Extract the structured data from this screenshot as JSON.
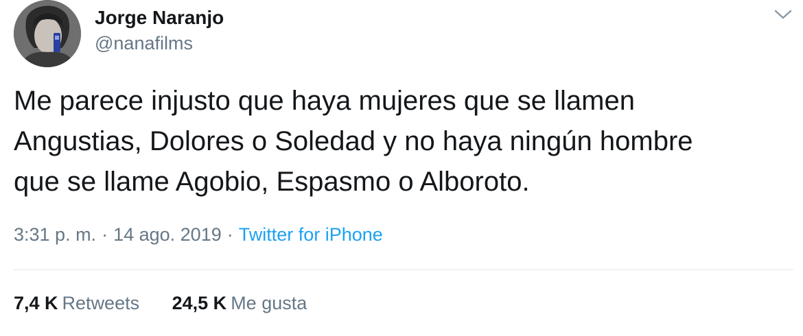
{
  "user": {
    "display_name": "Jorge Naranjo",
    "handle": "@nanafilms"
  },
  "tweet": {
    "text": "Me parece injusto que haya mujeres que se llamen\nAngustias, Dolores o Soledad y no haya ningún hombre\nque se llame Agobio, Espasmo o Alboroto.",
    "time": "3:31 p. m.",
    "separator": "·",
    "date": "14 ago. 2019",
    "source": "Twitter for iPhone"
  },
  "stats": {
    "retweets_count": "7,4 K",
    "retweets_label": "Retweets",
    "likes_count": "24,5 K",
    "likes_label": "Me gusta"
  },
  "icons": {
    "menu": "chevron-down-icon"
  },
  "colors": {
    "text": "#14171a",
    "secondary": "#657786",
    "link": "#1da1f2",
    "divider": "#e1e8ed"
  }
}
